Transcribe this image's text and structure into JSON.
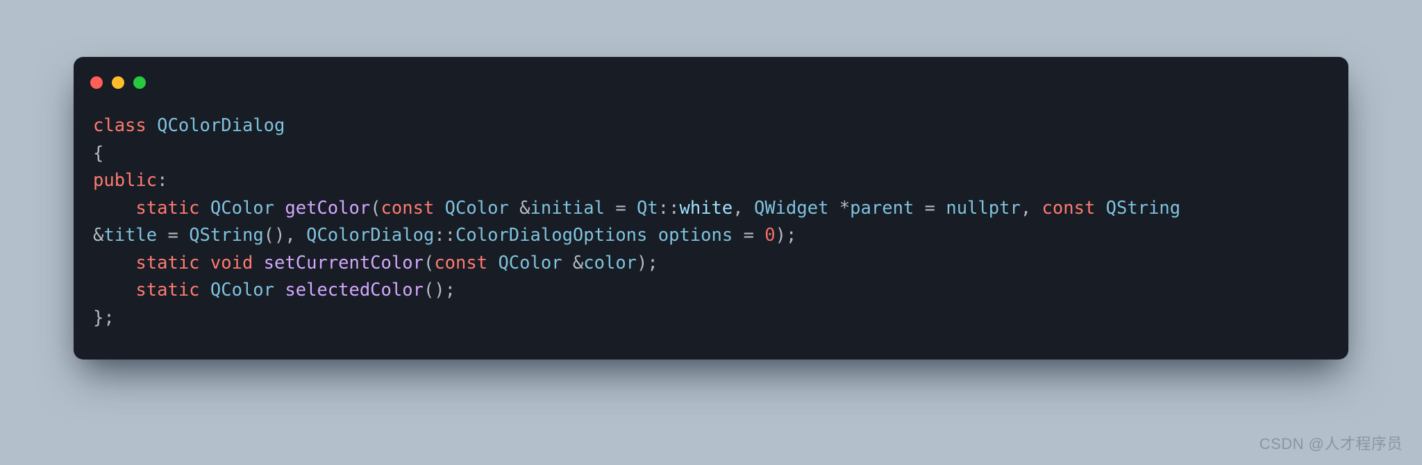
{
  "window": {
    "traffic_lights": [
      "red",
      "yellow",
      "green"
    ]
  },
  "code": {
    "tokens": [
      [
        {
          "t": "class ",
          "c": "tok-kw"
        },
        {
          "t": "QColorDialog",
          "c": "tok-type"
        }
      ],
      [
        {
          "t": "{",
          "c": "tok-punct"
        }
      ],
      [
        {
          "t": "public",
          "c": "tok-kw"
        },
        {
          "t": ":",
          "c": "tok-punct"
        }
      ],
      [
        {
          "t": "    ",
          "c": ""
        },
        {
          "t": "static ",
          "c": "tok-kw"
        },
        {
          "t": "QColor ",
          "c": "tok-type"
        },
        {
          "t": "getColor",
          "c": "tok-fn"
        },
        {
          "t": "(",
          "c": "tok-punct"
        },
        {
          "t": "const ",
          "c": "tok-kw"
        },
        {
          "t": "QColor ",
          "c": "tok-type"
        },
        {
          "t": "&",
          "c": "tok-punct"
        },
        {
          "t": "initial ",
          "c": "tok-type"
        },
        {
          "t": "= ",
          "c": "tok-punct"
        },
        {
          "t": "Qt",
          "c": "tok-ns"
        },
        {
          "t": "::",
          "c": "tok-punct"
        },
        {
          "t": "white",
          "c": "tok-str"
        },
        {
          "t": ", ",
          "c": "tok-punct"
        },
        {
          "t": "QWidget ",
          "c": "tok-type"
        },
        {
          "t": "*",
          "c": "tok-punct"
        },
        {
          "t": "parent ",
          "c": "tok-type"
        },
        {
          "t": "= ",
          "c": "tok-punct"
        },
        {
          "t": "nullptr",
          "c": "tok-null"
        },
        {
          "t": ", ",
          "c": "tok-punct"
        },
        {
          "t": "const ",
          "c": "tok-kw"
        },
        {
          "t": "QString",
          "c": "tok-type"
        }
      ],
      [
        {
          "t": "&",
          "c": "tok-punct"
        },
        {
          "t": "title ",
          "c": "tok-type"
        },
        {
          "t": "= ",
          "c": "tok-punct"
        },
        {
          "t": "QString",
          "c": "tok-type"
        },
        {
          "t": "(), ",
          "c": "tok-punct"
        },
        {
          "t": "QColorDialog",
          "c": "tok-type"
        },
        {
          "t": "::",
          "c": "tok-punct"
        },
        {
          "t": "ColorDialogOptions ",
          "c": "tok-type"
        },
        {
          "t": "options ",
          "c": "tok-type"
        },
        {
          "t": "= ",
          "c": "tok-punct"
        },
        {
          "t": "0",
          "c": "tok-num"
        },
        {
          "t": ");",
          "c": "tok-punct"
        }
      ],
      [
        {
          "t": "    ",
          "c": ""
        },
        {
          "t": "static ",
          "c": "tok-kw"
        },
        {
          "t": "void ",
          "c": "tok-kw"
        },
        {
          "t": "setCurrentColor",
          "c": "tok-fn"
        },
        {
          "t": "(",
          "c": "tok-punct"
        },
        {
          "t": "const ",
          "c": "tok-kw"
        },
        {
          "t": "QColor ",
          "c": "tok-type"
        },
        {
          "t": "&",
          "c": "tok-punct"
        },
        {
          "t": "color",
          "c": "tok-type"
        },
        {
          "t": ");",
          "c": "tok-punct"
        }
      ],
      [
        {
          "t": "    ",
          "c": ""
        },
        {
          "t": "static ",
          "c": "tok-kw"
        },
        {
          "t": "QColor ",
          "c": "tok-type"
        },
        {
          "t": "selectedColor",
          "c": "tok-fn"
        },
        {
          "t": "();",
          "c": "tok-punct"
        }
      ],
      [
        {
          "t": "};",
          "c": "tok-punct"
        }
      ]
    ]
  },
  "watermark": "CSDN @人才程序员"
}
